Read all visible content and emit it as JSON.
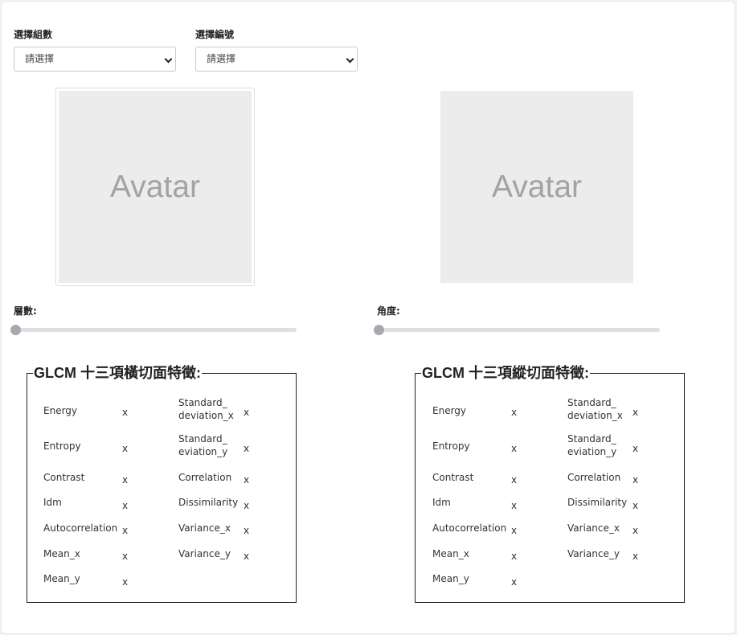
{
  "selectors": {
    "group": {
      "label": "選擇組數",
      "value": "請選擇"
    },
    "number": {
      "label": "選擇編號",
      "value": "請選擇"
    }
  },
  "avatars": {
    "left_text": "Avatar",
    "right_text": "Avatar"
  },
  "sliders": {
    "layers": {
      "label": "層數:",
      "value_fraction": 0
    },
    "angle": {
      "label": "角度:",
      "value_fraction": 0
    }
  },
  "horizontal_panel": {
    "title": "GLCM 十三項橫切面特徵:",
    "left_column": [
      {
        "name": "Energy",
        "value": "x"
      },
      {
        "name": "Entropy",
        "value": "x"
      },
      {
        "name": "Contrast",
        "value": "x"
      },
      {
        "name": "Idm",
        "value": "x"
      },
      {
        "name": "Autocorrelation",
        "value": "x"
      },
      {
        "name": "Mean_x",
        "value": "x"
      },
      {
        "name": "Mean_y",
        "value": "x"
      }
    ],
    "right_column": [
      {
        "line1": "Standard_",
        "line2": "deviation_x",
        "value": "x"
      },
      {
        "line1": "Standard_",
        "line2": "eviation_y",
        "value": "x"
      },
      {
        "name": "Correlation",
        "value": "x"
      },
      {
        "name": "Dissimilarity",
        "value": "x"
      },
      {
        "name": "Variance_x",
        "value": "x"
      },
      {
        "name": "Variance_y",
        "value": "x"
      }
    ]
  },
  "vertical_panel": {
    "title": "GLCM 十三項縱切面特徵:",
    "left_column": [
      {
        "name": "Energy",
        "value": "x"
      },
      {
        "name": "Entropy",
        "value": "x"
      },
      {
        "name": "Contrast",
        "value": "x"
      },
      {
        "name": "Idm",
        "value": "x"
      },
      {
        "name": "Autocorrelation",
        "value": "x"
      },
      {
        "name": "Mean_x",
        "value": "x"
      },
      {
        "name": "Mean_y",
        "value": "x"
      }
    ],
    "right_column": [
      {
        "line1": "Standard_",
        "line2": "deviation_x",
        "value": "x"
      },
      {
        "line1": "Standard_",
        "line2": "eviation_y",
        "value": "x"
      },
      {
        "name": "Correlation",
        "value": "x"
      },
      {
        "name": "Dissimilarity",
        "value": "x"
      },
      {
        "name": "Variance_x",
        "value": "x"
      },
      {
        "name": "Variance_y",
        "value": "x"
      }
    ]
  }
}
